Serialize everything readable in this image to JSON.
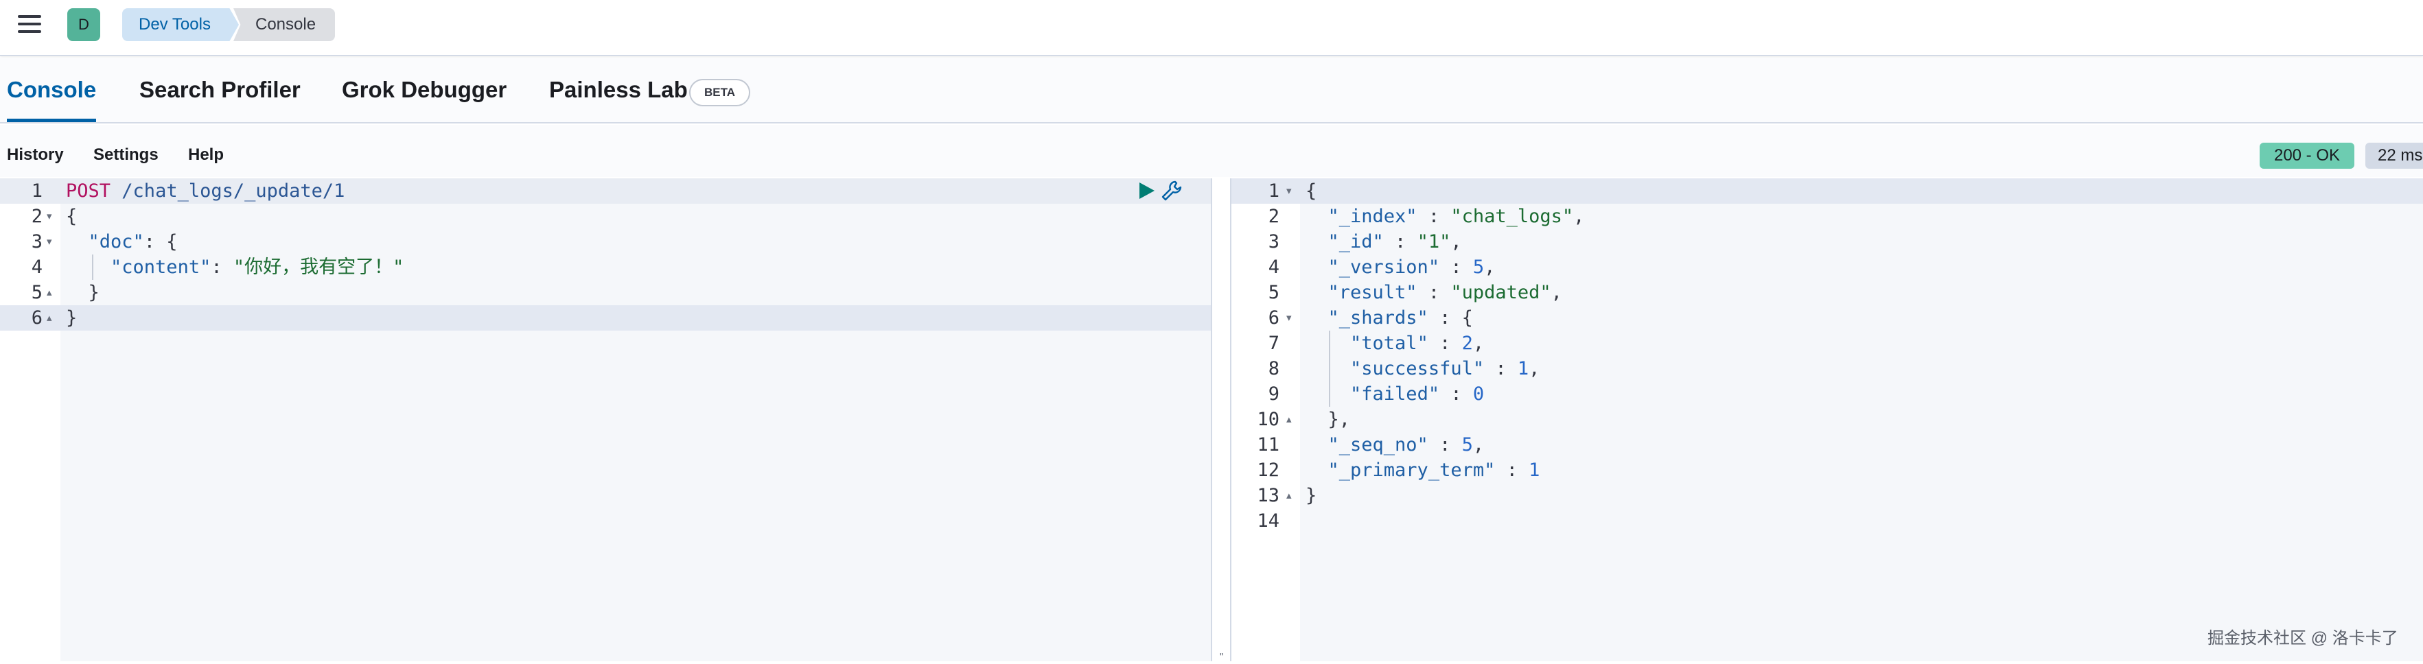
{
  "header": {
    "space_initial": "D",
    "breadcrumbs": [
      "Dev Tools",
      "Console"
    ]
  },
  "tabs": {
    "console": "Console",
    "search_profiler": "Search Profiler",
    "grok_debugger": "Grok Debugger",
    "painless_lab": "Painless Lab",
    "beta_badge": "BETA"
  },
  "toolbar": {
    "history": "History",
    "settings": "Settings",
    "help": "Help",
    "status": "200 - OK",
    "time": "22 ms"
  },
  "request": {
    "lines": [
      {
        "n": "1",
        "fold": ""
      },
      {
        "n": "2",
        "fold": "▾"
      },
      {
        "n": "3",
        "fold": "▾"
      },
      {
        "n": "4",
        "fold": ""
      },
      {
        "n": "5",
        "fold": "▴"
      },
      {
        "n": "6",
        "fold": "▴"
      }
    ],
    "method": "POST",
    "url": "/chat_logs/_update/1",
    "open_brace": "{",
    "doc_key": "\"doc\"",
    "doc_open": ": {",
    "content_key": "\"content\"",
    "content_sep": ": ",
    "content_value": "\"你好，我有空了！\"",
    "inner_close": "}",
    "outer_close": "}"
  },
  "response": {
    "lines": [
      {
        "n": "1",
        "fold": "▾"
      },
      {
        "n": "2",
        "fold": ""
      },
      {
        "n": "3",
        "fold": ""
      },
      {
        "n": "4",
        "fold": ""
      },
      {
        "n": "5",
        "fold": ""
      },
      {
        "n": "6",
        "fold": "▾"
      },
      {
        "n": "7",
        "fold": ""
      },
      {
        "n": "8",
        "fold": ""
      },
      {
        "n": "9",
        "fold": ""
      },
      {
        "n": "10",
        "fold": "▴"
      },
      {
        "n": "11",
        "fold": ""
      },
      {
        "n": "12",
        "fold": ""
      },
      {
        "n": "13",
        "fold": "▴"
      },
      {
        "n": "14",
        "fold": ""
      }
    ],
    "open_brace": "{",
    "index_key": "\"_index\"",
    "index_val": "\"chat_logs\"",
    "id_key": "\"_id\"",
    "id_val": "\"1\"",
    "version_key": "\"_version\"",
    "version_val": "5",
    "result_key": "\"result\"",
    "result_val": "\"updated\"",
    "shards_key": "\"_shards\"",
    "total_key": "\"total\"",
    "total_val": "2",
    "successful_key": "\"successful\"",
    "successful_val": "1",
    "failed_key": "\"failed\"",
    "failed_val": "0",
    "shards_close": "},",
    "seq_key": "\"_seq_no\"",
    "seq_val": "5",
    "primary_key": "\"_primary_term\"",
    "primary_val": "1",
    "close_brace": "}"
  },
  "watermark": "掘金技术社区 @ 洛卡卡了",
  "divider_grip": "\""
}
